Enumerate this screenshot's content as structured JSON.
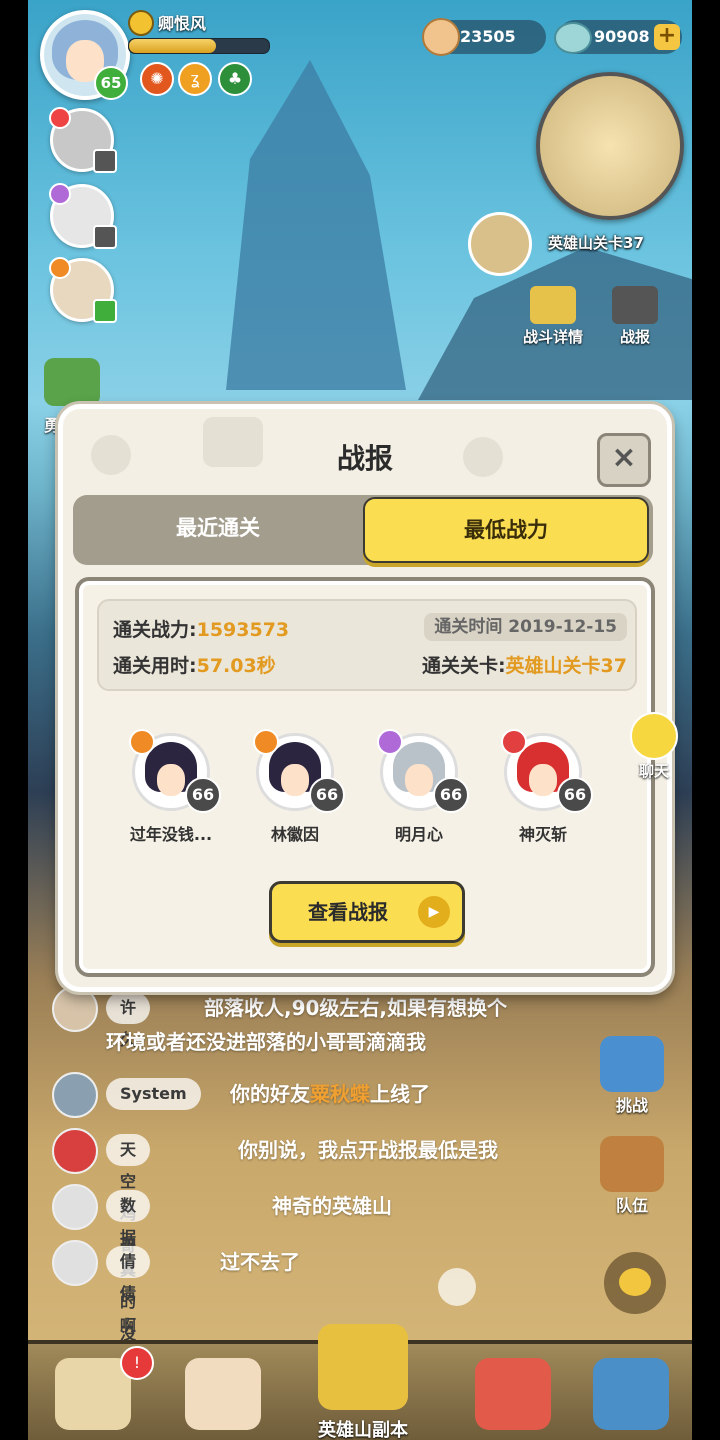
{
  "player": {
    "name": "卿恨风",
    "level": "65",
    "exp_fraction": 0.62
  },
  "currency": {
    "coins": "23505",
    "gems": "90908",
    "plus": "+"
  },
  "map": {
    "stage_label": "英雄山关卡37"
  },
  "tools": {
    "battle_detail": "战斗详情",
    "battle_report": "战报"
  },
  "side_partial": "勇",
  "dialog": {
    "title": "战报",
    "close": "×",
    "tabs": [
      {
        "label": "最近通关",
        "active": false
      },
      {
        "label": "最低战力",
        "active": true
      }
    ],
    "info": {
      "power_label": "通关战力:",
      "power_value": "1593573",
      "time_label": "通关用时:",
      "time_value": "57.03秒",
      "date_label": "通关时间",
      "date_value": "2019-12-15",
      "stage_label": "通关关卡:",
      "stage_value": "英雄山关卡37"
    },
    "heroes": [
      {
        "name": "过年没钱...",
        "level": "66",
        "elem_color": "#f08a24",
        "hair_color": "#2b2540"
      },
      {
        "name": "林徽因",
        "level": "66",
        "elem_color": "#f08a24",
        "hair_color": "#2b2540"
      },
      {
        "name": "明月心",
        "level": "66",
        "elem_color": "#b06ad8",
        "hair_color": "#b8c2c8"
      },
      {
        "name": "神灭斩",
        "level": "66",
        "elem_color": "#e24040",
        "hair_color": "#d83030"
      }
    ],
    "view_button": "查看战报",
    "play_glyph": "▶"
  },
  "chat_side": {
    "label": "聊天"
  },
  "chat": [
    {
      "name": "许久",
      "message": "部落收人,90级左右,如果有想换个",
      "message2": "环境或者还没进部落的小哥哥滴滴我"
    },
    {
      "name": "System",
      "message_pre": "你的好友",
      "message_hl": "粟秋蝶",
      "message_post": "上线了"
    },
    {
      "name": "天空鸡哥",
      "message": "你别说，我点开战报最低是我"
    },
    {
      "name": "数据真的没了",
      "message": "神奇的英雄山"
    },
    {
      "name": "倩倩啊",
      "message": "过不去了"
    }
  ],
  "right_buttons": {
    "challenge": "挑战",
    "team": "队伍"
  },
  "bottom_nav": {
    "center_label": "英雄山副本",
    "badge": "!"
  }
}
